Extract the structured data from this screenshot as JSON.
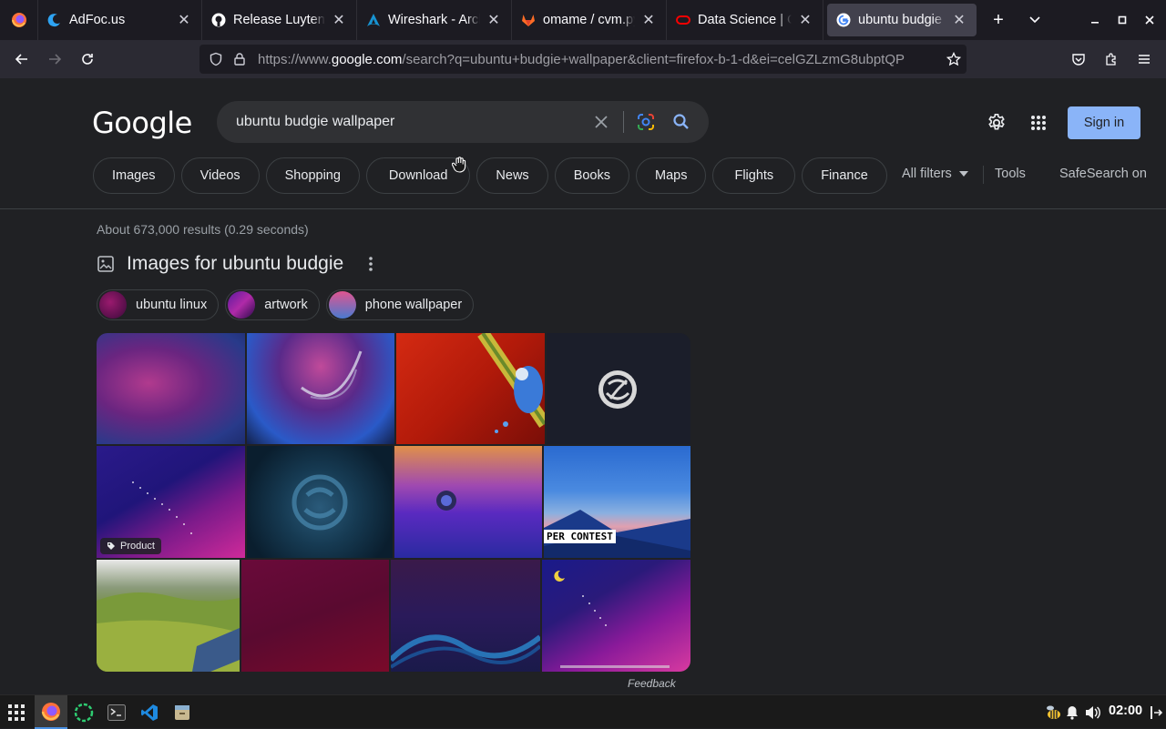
{
  "tabs": [
    {
      "title": "AdFoc.us",
      "favicon": "adfocus-icon"
    },
    {
      "title": "Release LuytenX | x",
      "favicon": "github-icon"
    },
    {
      "title": "Wireshark - Arch L",
      "favicon": "arch-icon"
    },
    {
      "title": "omame / cvm.py",
      "favicon": "gitlab-icon"
    },
    {
      "title": "Data Science | Ora",
      "favicon": "oracle-icon"
    },
    {
      "title": "ubuntu budgie wal",
      "favicon": "google-icon",
      "active": true
    }
  ],
  "url": {
    "prefix": "https://www.",
    "domain": "google.com",
    "path": "/search?q=ubuntu+budgie+wallpaper&client=firefox-b-1-d&ei=celGZLzmG8ubptQP"
  },
  "google": {
    "logo": "Google",
    "query": "ubuntu budgie wallpaper",
    "signin": "Sign in",
    "chips": [
      "Images",
      "Videos",
      "Shopping",
      "Download",
      "News",
      "Books",
      "Maps",
      "Flights",
      "Finance"
    ],
    "all_filters": "All filters",
    "tools": "Tools",
    "safesearch": "SafeSearch on",
    "stats": "About 673,000 results (0.29 seconds)",
    "images_heading": "Images for ubuntu budgie",
    "refinements": [
      "ubuntu linux",
      "artwork",
      "phone wallpaper"
    ],
    "product_tag": "Product",
    "contest_text": "PER CONTEST",
    "feedback": "Feedback"
  },
  "taskbar": {
    "clock": "02:00"
  }
}
